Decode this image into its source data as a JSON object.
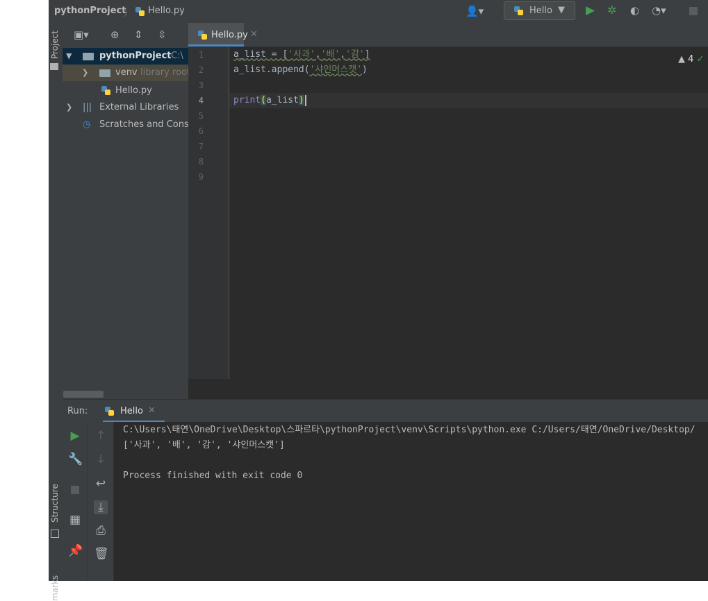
{
  "navbar": {
    "project_name": "pythonProject",
    "file_name": "Hello.py",
    "run_config_label": "Hello"
  },
  "left_stripe": {
    "project_label": "Project",
    "structure_label": "Structure",
    "bookmarks_label": "marks"
  },
  "project_tree": {
    "items": [
      {
        "label": "pythonProject",
        "suffix": "C:\\"
      },
      {
        "label": "venv",
        "suffix": "library root"
      },
      {
        "label": "Hello.py"
      },
      {
        "label": "External Libraries"
      },
      {
        "label": "Scratches and Consoles"
      }
    ]
  },
  "editor": {
    "tab_label": "Hello.py",
    "line_numbers": [
      "1",
      "2",
      "3",
      "4",
      "5",
      "6",
      "7",
      "8",
      "9"
    ],
    "current_line": "4",
    "warning_count": "4",
    "code": {
      "l1_var": "a_list = [",
      "l1_s1": "'사과'",
      "l1_c1": ",",
      "l1_s2": "'배'",
      "l1_c2": ",",
      "l1_s3": "'감'",
      "l1_end": "]",
      "l2_call": "a_list.append(",
      "l2_s1": "'샤인머스캣'",
      "l2_end": ")",
      "l4_fn": "print",
      "l4_open": "(",
      "l4_arg": "a_list",
      "l4_close": ")"
    }
  },
  "run_panel": {
    "run_label": "Run:",
    "tab_label": "Hello",
    "console_lines": [
      "C:\\Users\\태연\\OneDrive\\Desktop\\스파르타\\pythonProject\\venv\\Scripts\\python.exe C:/Users/태연/OneDrive/Desktop/",
      "['사과', '배', '감', '샤인머스캣']",
      "",
      "Process finished with exit code 0"
    ]
  },
  "colors": {
    "accent": "#4a88c7",
    "run_green": "#499c54",
    "editor_bg": "#2b2b2b",
    "panel_bg": "#3c3f41",
    "string_green": "#6a8759"
  },
  "icons": {
    "toolbar": [
      "user-icon",
      "run-icon",
      "debug-icon",
      "coverage-icon",
      "profile-icon",
      "stop-icon"
    ],
    "run_toolbar": [
      "rerun-icon",
      "wrench-icon",
      "stop-icon",
      "layout-icon",
      "pin-icon",
      "up-arrow-icon",
      "down-arrow-icon",
      "soft-wrap-icon",
      "scroll-to-end-icon",
      "print-icon",
      "trash-icon"
    ]
  }
}
